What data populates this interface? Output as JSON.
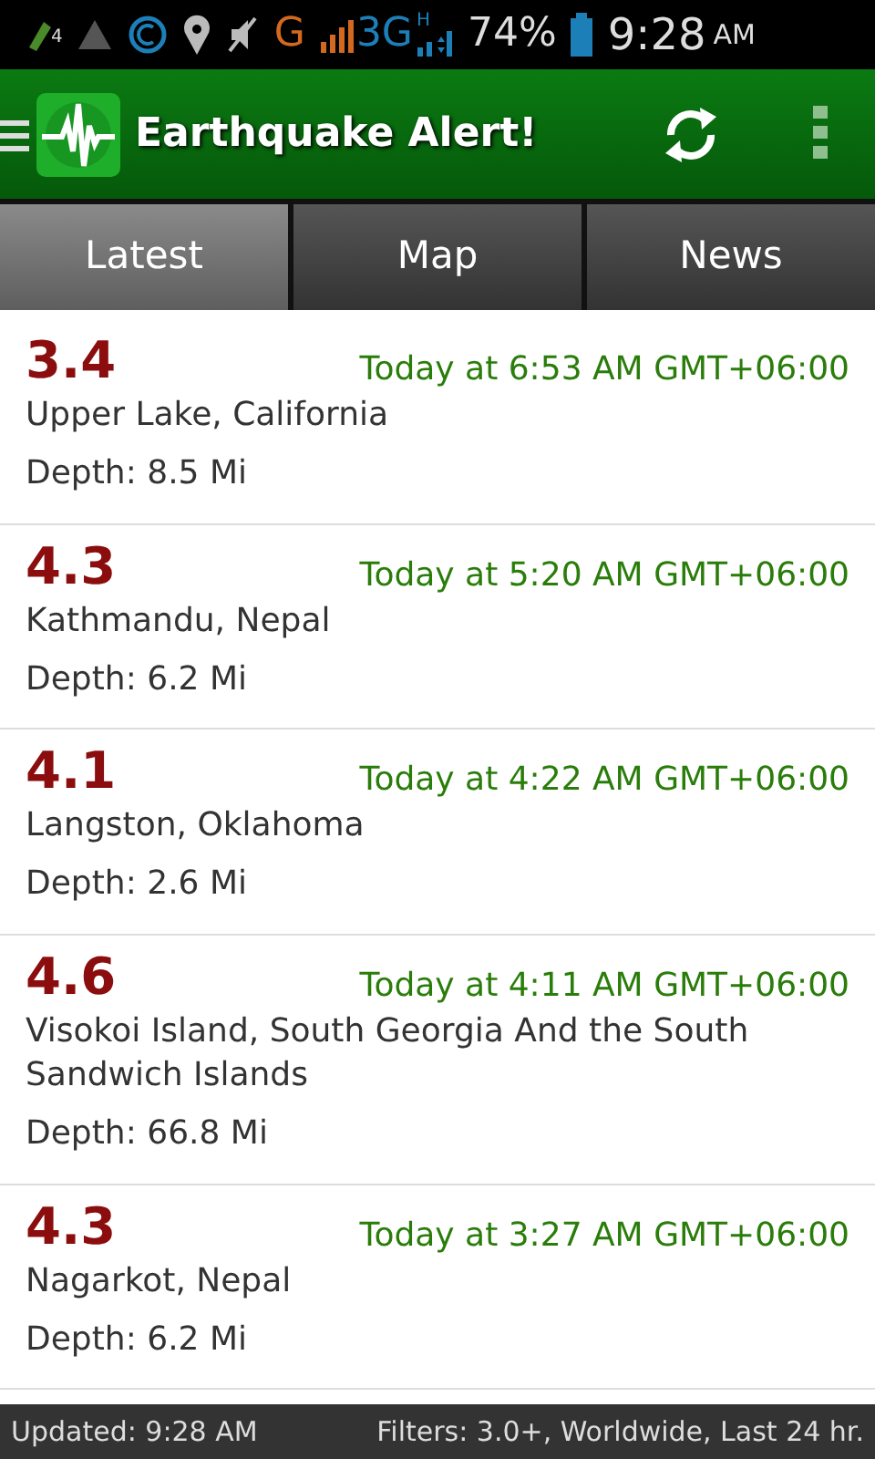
{
  "status_bar": {
    "sim_badge": "4",
    "network_g": "G",
    "network_3g": "3G",
    "network_h": "H",
    "battery": "74%",
    "time": "9:28",
    "time_suffix": "AM"
  },
  "app_bar": {
    "title": "Earthquake Alert!"
  },
  "tabs": [
    {
      "label": "Latest",
      "selected": true
    },
    {
      "label": "Map",
      "selected": false
    },
    {
      "label": "News",
      "selected": false
    }
  ],
  "quakes": [
    {
      "magnitude": "3.4",
      "time": "Today at 6:53 AM GMT+06:00",
      "place": "Upper Lake, California",
      "depth": "Depth: 8.5 Mi"
    },
    {
      "magnitude": "4.3",
      "time": "Today at 5:20 AM GMT+06:00",
      "place": "Kathmandu, Nepal",
      "depth": "Depth: 6.2 Mi"
    },
    {
      "magnitude": "4.1",
      "time": "Today at 4:22 AM GMT+06:00",
      "place": "Langston, Oklahoma",
      "depth": "Depth: 2.6 Mi"
    },
    {
      "magnitude": "4.6",
      "time": "Today at 4:11 AM GMT+06:00",
      "place": "Visokoi Island, South Georgia And the South Sandwich Islands",
      "depth": "Depth: 66.8 Mi"
    },
    {
      "magnitude": "4.3",
      "time": "Today at 3:27 AM GMT+06:00",
      "place": "Nagarkot, Nepal",
      "depth": "Depth: 6.2 Mi"
    }
  ],
  "footer": {
    "updated": "Updated: 9:28 AM",
    "filters": "Filters: 3.0+, Worldwide, Last 24 hr."
  }
}
